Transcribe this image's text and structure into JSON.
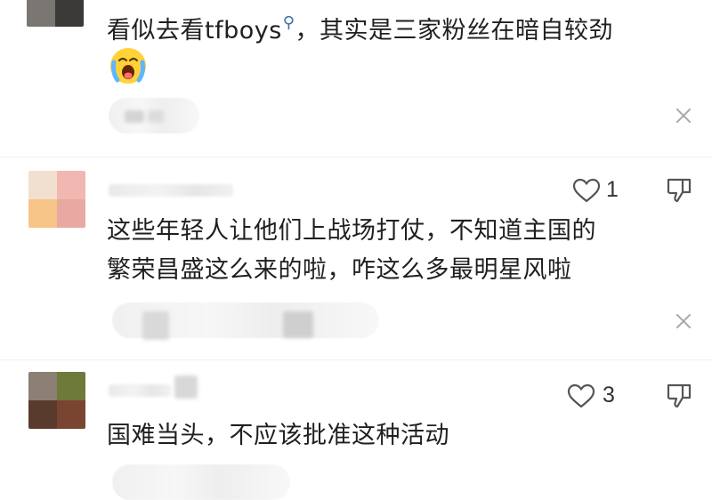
{
  "comments": [
    {
      "text_before": "看似去看tfboys",
      "search_icon": "search-icon",
      "text_after": "，其实是三家粉丝在暗自较劲",
      "emoji": "crying-face-emoji"
    },
    {
      "likes": "1",
      "text_line1": "这些年轻人让他们上战场打仗，不知道主国的",
      "text_line2": "繁荣昌盛这么来的啦，咋这么多最明星风啦"
    },
    {
      "likes": "3",
      "text_line1": "国难当头，不应该批准这种活动"
    }
  ],
  "icons": {
    "like": "heart-outline-icon",
    "dislike": "thumbs-down-icon",
    "close": "close-icon"
  },
  "colors": {
    "text": "#1f1f1f",
    "link": "#3b6ea8",
    "icon": "#555555",
    "close": "#a8a8a8"
  }
}
